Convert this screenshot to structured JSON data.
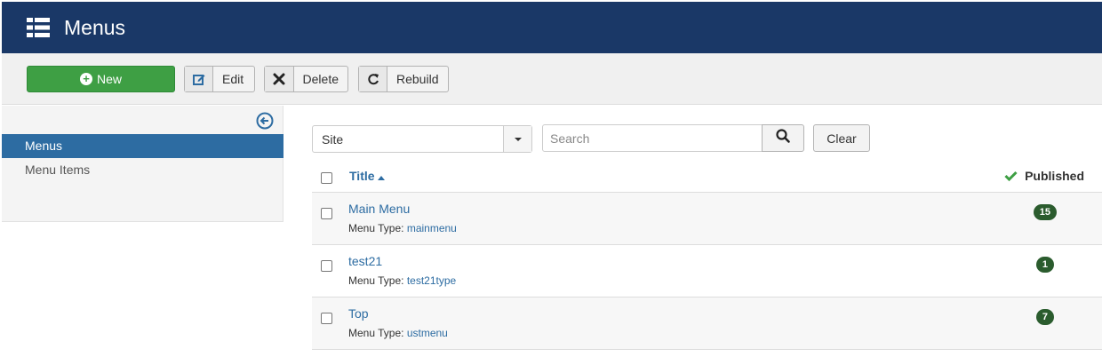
{
  "header": {
    "title": "Menus",
    "icon": "list-icon"
  },
  "toolbar": {
    "new_label": "New",
    "edit_label": "Edit",
    "delete_label": "Delete",
    "rebuild_label": "Rebuild"
  },
  "sidebar": {
    "items": [
      {
        "label": "Menus",
        "active": true
      },
      {
        "label": "Menu Items",
        "active": false
      }
    ]
  },
  "filters": {
    "client_value": "Site",
    "search_placeholder": "Search",
    "clear_label": "Clear"
  },
  "table": {
    "col_title": "Title",
    "col_published": "Published",
    "type_prefix": "Menu Type:",
    "rows": [
      {
        "title": "Main Menu",
        "menutype": "mainmenu",
        "published": "15"
      },
      {
        "title": "test21",
        "menutype": "test21type",
        "published": "1"
      },
      {
        "title": "Top",
        "menutype": "ustmenu",
        "published": "7"
      }
    ]
  },
  "colors": {
    "header_bg": "#1a3867",
    "new_button": "#3e9f44",
    "active_sidebar": "#2d6ca2",
    "link": "#2d6ca2",
    "badge": "#2b5c2e"
  }
}
